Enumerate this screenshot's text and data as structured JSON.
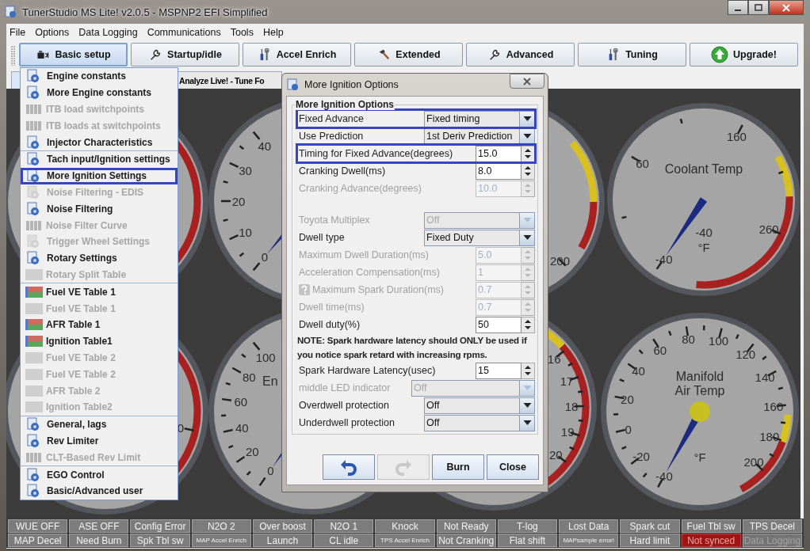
{
  "window": {
    "title": "TunerStudio MS Lite! v2.0.5 - MSPNP2 EFI Simplified"
  },
  "menu_bar": [
    "File",
    "Options",
    "Data Logging",
    "Communications",
    "Tools",
    "Help"
  ],
  "toolbar": [
    {
      "label": "Basic setup",
      "selected": true
    },
    {
      "label": "Startup/idle",
      "selected": false
    },
    {
      "label": "Accel Enrich",
      "selected": false
    },
    {
      "label": "Extended",
      "selected": false
    },
    {
      "label": "Advanced",
      "selected": false
    },
    {
      "label": "Tuning",
      "selected": false
    },
    {
      "label": "Upgrade!",
      "selected": false
    }
  ],
  "tabs": [
    {
      "selected": true
    },
    {
      "label": "Analyze Live! - Tune Fo",
      "selected": false
    }
  ],
  "dropdown_menu": {
    "groups": [
      [
        {
          "label": "Engine constants",
          "kind": "form",
          "disabled": false,
          "selected": false
        },
        {
          "label": "More Engine constants",
          "kind": "form",
          "disabled": false,
          "selected": false
        },
        {
          "label": "ITB load switchpoints",
          "kind": "curve",
          "disabled": true,
          "selected": false
        },
        {
          "label": "ITB loads at switchpoints",
          "kind": "curve",
          "disabled": true,
          "selected": false
        },
        {
          "label": "Injector Characteristics",
          "kind": "form",
          "disabled": false,
          "selected": false
        }
      ],
      [
        {
          "label": "Tach input/Ignition settings",
          "kind": "form",
          "disabled": false,
          "selected": false
        },
        {
          "label": "More Ignition Settings",
          "kind": "form",
          "disabled": false,
          "selected": true
        },
        {
          "label": "Noise Filtering - EDIS",
          "kind": "form",
          "disabled": true,
          "selected": false
        },
        {
          "label": "Noise Filtering",
          "kind": "form",
          "disabled": false,
          "selected": false
        },
        {
          "label": "Noise Filter Curve",
          "kind": "curve",
          "disabled": true,
          "selected": false
        },
        {
          "label": "Trigger Wheel Settings",
          "kind": "form",
          "disabled": true,
          "selected": false
        },
        {
          "label": "Rotary Settings",
          "kind": "form",
          "disabled": false,
          "selected": false
        },
        {
          "label": "Rotary Split Table",
          "kind": "table",
          "disabled": true,
          "selected": false
        }
      ],
      [
        {
          "label": "Fuel VE Table 1",
          "kind": "table",
          "disabled": false,
          "selected": false
        },
        {
          "label": "Fuel VE Table 1",
          "kind": "table",
          "disabled": true,
          "selected": false
        },
        {
          "label": "AFR Table 1",
          "kind": "table",
          "disabled": false,
          "selected": false
        },
        {
          "label": "Ignition Table1",
          "kind": "table",
          "disabled": false,
          "selected": false
        },
        {
          "label": "Fuel VE Table 2",
          "kind": "table",
          "disabled": true,
          "selected": false
        },
        {
          "label": "Fuel VE Table 2",
          "kind": "table",
          "disabled": true,
          "selected": false
        },
        {
          "label": "AFR Table 2",
          "kind": "table",
          "disabled": true,
          "selected": false
        },
        {
          "label": "Ignition Table2",
          "kind": "table",
          "disabled": true,
          "selected": false
        }
      ],
      [
        {
          "label": "General, lags",
          "kind": "form",
          "disabled": false,
          "selected": false
        },
        {
          "label": "Rev Limiter",
          "kind": "form",
          "disabled": false,
          "selected": false
        },
        {
          "label": "CLT-Based Rev Limit",
          "kind": "curve",
          "disabled": true,
          "selected": false
        }
      ],
      [
        {
          "label": "EGO Control",
          "kind": "form",
          "disabled": false,
          "selected": false
        },
        {
          "label": "Basic/Advanced user",
          "kind": "form",
          "disabled": false,
          "selected": false
        }
      ]
    ]
  },
  "gauges": [
    {
      "ticks": [
        "0",
        "10",
        "20",
        "30",
        "40"
      ]
    },
    {
      "ticks": [
        "200"
      ]
    },
    {
      "title": "Coolant Temp",
      "value": "-40",
      "units": "°F",
      "ticks": [
        "-40",
        "60",
        "160",
        "260"
      ]
    },
    {
      "ticks": [
        "0"
      ]
    },
    {
      "title": "En",
      "ticks": [
        "0",
        "20",
        "40",
        "60",
        "80",
        "100"
      ]
    },
    {
      "ticks": [
        "16",
        "17",
        "18",
        "19",
        "20"
      ]
    },
    {
      "title_lines": [
        "Manifold",
        "Air Temp"
      ],
      "units": "°F",
      "ticks": [
        "-40",
        "-20",
        "0",
        "20",
        "40",
        "60",
        "80",
        "100",
        "120",
        "140",
        "160",
        "180",
        "200"
      ]
    }
  ],
  "dialog": {
    "title": "More Ignition Options",
    "group_title": "More Ignition Options",
    "sections": [
      [
        {
          "kind": "select",
          "label": "Fixed Advance",
          "value": "Fixed timing",
          "disabled": false,
          "highlighted": true
        },
        {
          "kind": "select",
          "label": "Use Prediction",
          "value": "1st Deriv Prediction",
          "disabled": false,
          "highlighted": false
        },
        {
          "kind": "spinner",
          "label": "Timing for Fixed Advance(degrees)",
          "value": "15.0",
          "disabled": false,
          "highlighted": true
        },
        {
          "kind": "spinner",
          "label": "Cranking Dwell(ms)",
          "value": "8.0",
          "disabled": false,
          "highlighted": false
        },
        {
          "kind": "spinner",
          "label": "Cranking Advance(degrees)",
          "value": "10.0",
          "disabled": true,
          "highlighted": false
        }
      ],
      [
        {
          "kind": "select",
          "label": "Toyota Multiplex",
          "value": "Off",
          "disabled": true,
          "highlighted": false
        },
        {
          "kind": "select",
          "label": "Dwell type",
          "value": "Fixed Duty",
          "disabled": false,
          "highlighted": false
        },
        {
          "kind": "spinner",
          "label": "Maximum Dwell Duration(ms)",
          "value": "5.0",
          "disabled": true,
          "highlighted": false
        },
        {
          "kind": "spinner",
          "label": "Acceleration Compensation(ms)",
          "value": "1",
          "disabled": true,
          "highlighted": false
        },
        {
          "kind": "spinner",
          "label": "Maximum Spark Duration(ms)",
          "value": "0.7",
          "disabled": true,
          "highlighted": false,
          "help": true
        },
        {
          "kind": "spinner",
          "label": "Dwell time(ms)",
          "value": "0.7",
          "disabled": true,
          "highlighted": false
        },
        {
          "kind": "spinner",
          "label": "Dwell duty(%)",
          "value": "50",
          "disabled": false,
          "highlighted": false
        },
        {
          "kind": "note",
          "text": "NOTE: Spark hardware latency should ONLY be used if you notice spark retard with increasing rpms."
        },
        {
          "kind": "spinner",
          "label": "Spark Hardware Latency(usec)",
          "value": "15",
          "disabled": false,
          "highlighted": false
        },
        {
          "kind": "wideselect",
          "label": "middle LED indicator",
          "value": "Off",
          "disabled": true,
          "highlighted": false
        },
        {
          "kind": "select",
          "label": "Overdwell protection",
          "value": "Off",
          "disabled": false,
          "highlighted": false
        },
        {
          "kind": "select",
          "label": "Underdwell protection",
          "value": "Off",
          "disabled": false,
          "highlighted": false
        }
      ]
    ],
    "buttons": [
      {
        "kind": "undo",
        "disabled": false
      },
      {
        "kind": "redo",
        "disabled": true
      },
      {
        "kind": "text",
        "label": "Burn",
        "disabled": false
      },
      {
        "kind": "text",
        "label": "Close",
        "disabled": false
      }
    ]
  },
  "status_bar": {
    "rows": [
      [
        {
          "label": "WUE OFF",
          "alert": false,
          "disabled": false
        },
        {
          "label": "ASE OFF",
          "alert": false,
          "disabled": false
        },
        {
          "label": "Config Error",
          "alert": false,
          "disabled": false
        },
        {
          "label": "N2O 2",
          "alert": false,
          "disabled": false
        },
        {
          "label": "Over boost",
          "alert": false,
          "disabled": false
        },
        {
          "label": "N2O 1",
          "alert": false,
          "disabled": false
        },
        {
          "label": "Knock",
          "alert": false,
          "disabled": false
        },
        {
          "label": "Not Ready",
          "alert": false,
          "disabled": false
        },
        {
          "label": "T-log",
          "alert": false,
          "disabled": false
        },
        {
          "label": "Lost Data",
          "alert": false,
          "disabled": false
        },
        {
          "label": "Spark cut",
          "alert": false,
          "disabled": false
        },
        {
          "label": "Fuel Tbl sw",
          "alert": false,
          "disabled": false
        },
        {
          "label": "TPS Decel",
          "alert": false,
          "disabled": false
        }
      ],
      [
        {
          "label": "MAP Decel",
          "alert": false,
          "disabled": false
        },
        {
          "label": "Need Burn",
          "alert": false,
          "disabled": false
        },
        {
          "label": "Spk Tbl sw",
          "alert": false,
          "disabled": false
        },
        {
          "label": "MAP Accel Enrich",
          "alert": false,
          "disabled": false
        },
        {
          "label": "Launch",
          "alert": false,
          "disabled": false
        },
        {
          "label": "CL idle",
          "alert": false,
          "disabled": false
        },
        {
          "label": "TPS Accel Enrich",
          "alert": false,
          "disabled": false
        },
        {
          "label": "Not Cranking",
          "alert": false,
          "disabled": false
        },
        {
          "label": "Flat shift",
          "alert": false,
          "disabled": false
        },
        {
          "label": "MAPsample error!",
          "alert": false,
          "disabled": false
        },
        {
          "label": "Hard limit",
          "alert": false,
          "disabled": false
        },
        {
          "label": "Not synced",
          "alert": true,
          "disabled": false
        },
        {
          "label": "Data Logging",
          "alert": false,
          "disabled": true
        }
      ]
    ]
  }
}
